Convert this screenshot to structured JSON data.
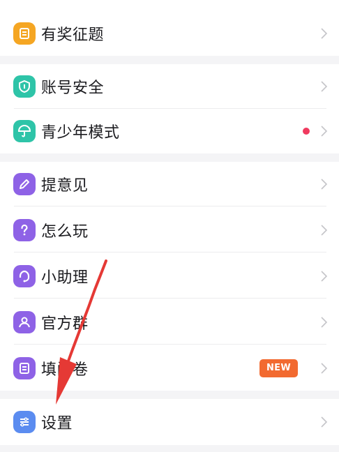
{
  "colors": {
    "background": "#f4f4f6",
    "icon_orange": "#f5a623",
    "icon_teal": "#2ec4a8",
    "icon_purple": "#8e62e6",
    "icon_blue": "#5b8cf0",
    "red_dot": "#f03a5f",
    "badge_orange": "#f26a30",
    "chevron": "#c4c4c8",
    "arrow_red": "#e53935"
  },
  "menu": {
    "prize_questions": {
      "label": "有奖征题",
      "icon": "document-icon"
    },
    "account_security": {
      "label": "账号安全",
      "icon": "shield-icon"
    },
    "teen_mode": {
      "label": "青少年模式",
      "icon": "umbrella-icon",
      "has_red_dot": true
    },
    "feedback": {
      "label": "提意见",
      "icon": "pencil-icon"
    },
    "how_to_play": {
      "label": "怎么玩",
      "icon": "question-icon"
    },
    "assistant": {
      "label": "小助理",
      "icon": "headset-icon"
    },
    "official_group": {
      "label": "官方群",
      "icon": "group-icon"
    },
    "survey": {
      "label": "填问卷",
      "icon": "form-icon",
      "badge": "NEW"
    },
    "settings": {
      "label": "设置",
      "icon": "sliders-icon"
    }
  }
}
